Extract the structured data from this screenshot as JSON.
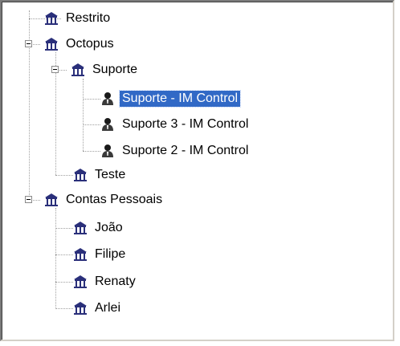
{
  "tree": {
    "nodes": [
      {
        "label": "Restrito",
        "icon": "house-icon"
      },
      {
        "label": "Octopus",
        "icon": "house-icon"
      },
      {
        "label": "Suporte",
        "icon": "house-icon"
      },
      {
        "label": "Suporte - IM Control",
        "icon": "user-icon",
        "selected": true
      },
      {
        "label": "Suporte 3 - IM Control",
        "icon": "user-icon"
      },
      {
        "label": "Suporte 2 - IM Control",
        "icon": "user-icon"
      },
      {
        "label": "Teste",
        "icon": "house-icon"
      },
      {
        "label": "Contas Pessoais",
        "icon": "house-icon"
      },
      {
        "label": "João",
        "icon": "house-icon"
      },
      {
        "label": "Filipe",
        "icon": "house-icon"
      },
      {
        "label": "Renaty",
        "icon": "house-icon"
      },
      {
        "label": "Arlei",
        "icon": "house-icon"
      }
    ]
  },
  "colors": {
    "house_icon": "#2a2f7a",
    "selection": "#3169c6",
    "tree_lines": "#a0a0a0"
  }
}
